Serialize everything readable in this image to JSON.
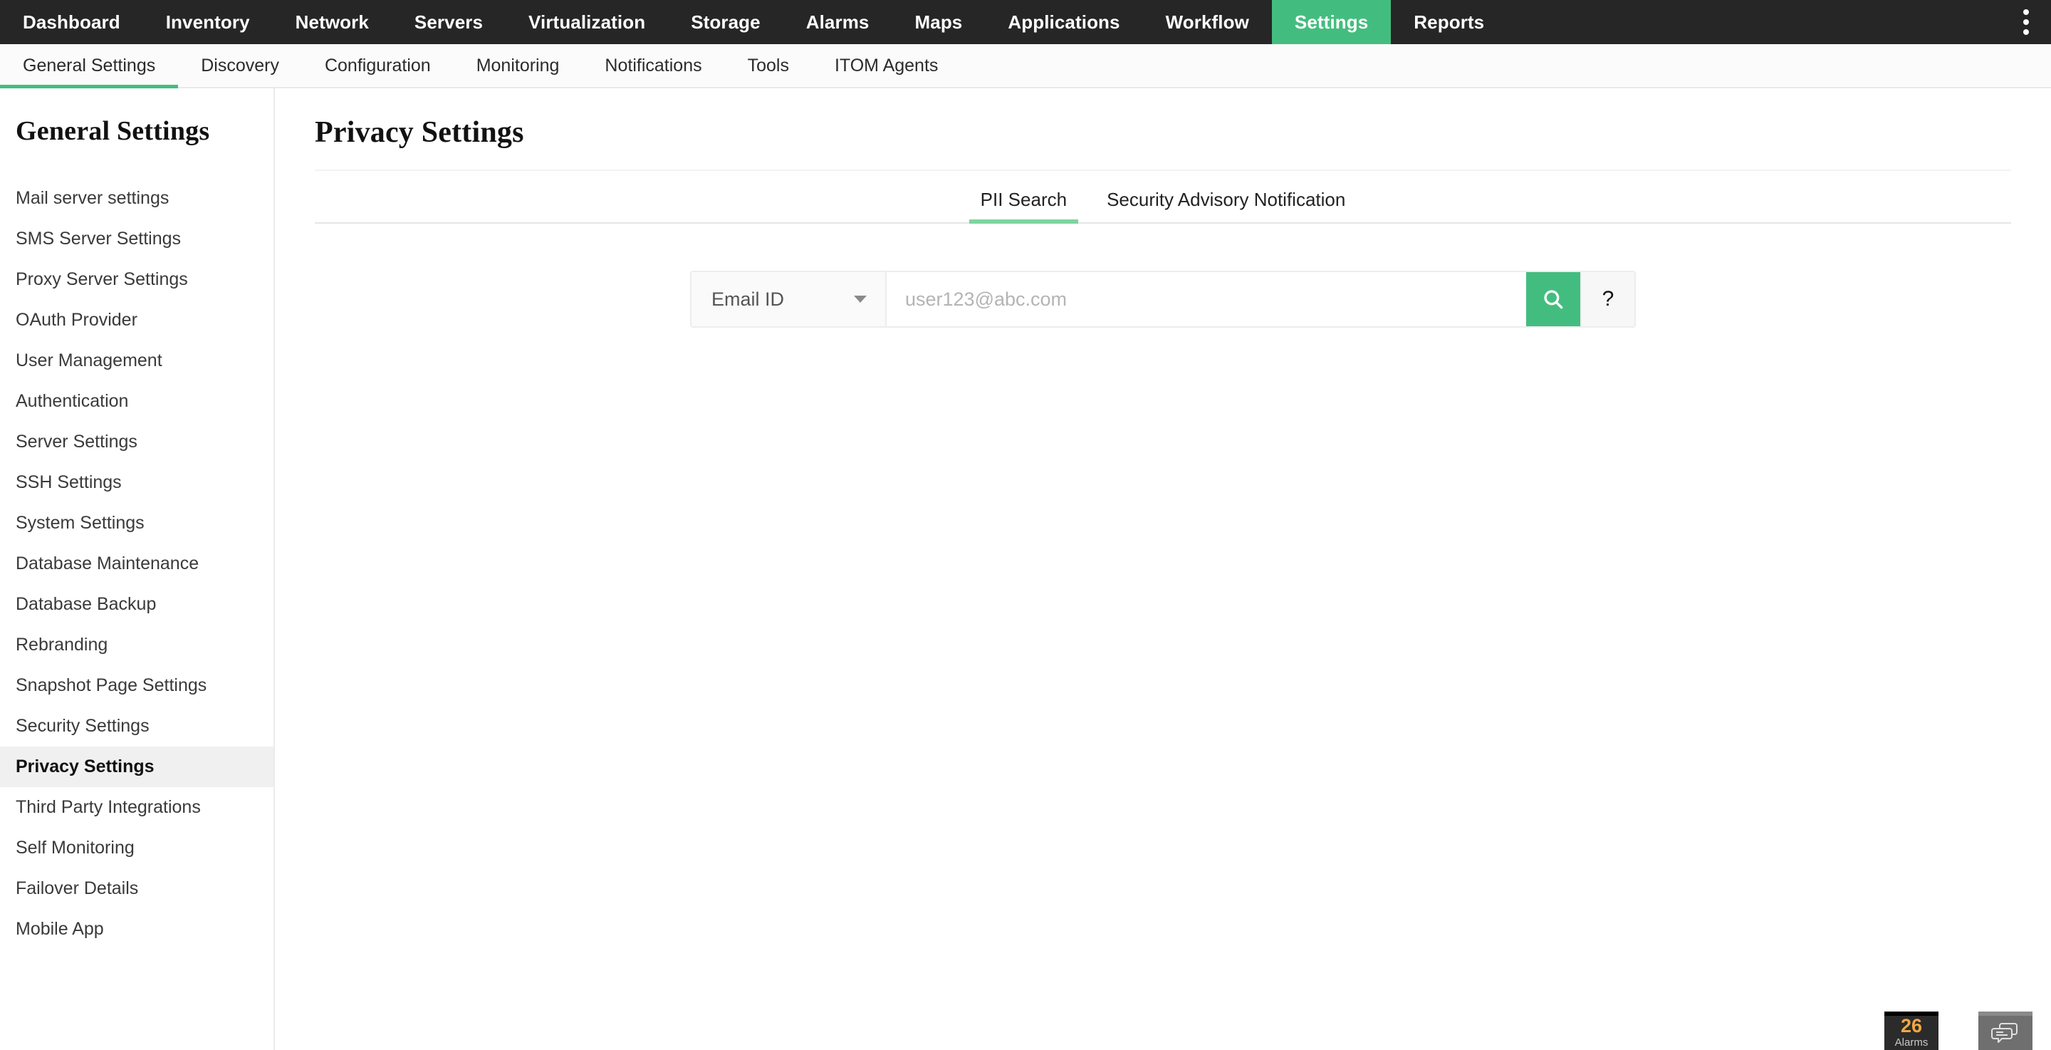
{
  "topnav": {
    "items": [
      {
        "label": "Dashboard",
        "active": false
      },
      {
        "label": "Inventory",
        "active": false
      },
      {
        "label": "Network",
        "active": false
      },
      {
        "label": "Servers",
        "active": false
      },
      {
        "label": "Virtualization",
        "active": false
      },
      {
        "label": "Storage",
        "active": false
      },
      {
        "label": "Alarms",
        "active": false
      },
      {
        "label": "Maps",
        "active": false
      },
      {
        "label": "Applications",
        "active": false
      },
      {
        "label": "Workflow",
        "active": false
      },
      {
        "label": "Settings",
        "active": true
      },
      {
        "label": "Reports",
        "active": false
      }
    ],
    "menu_icon": "kebab-menu-icon"
  },
  "subnav": {
    "items": [
      {
        "label": "General Settings",
        "active": true
      },
      {
        "label": "Discovery",
        "active": false
      },
      {
        "label": "Configuration",
        "active": false
      },
      {
        "label": "Monitoring",
        "active": false
      },
      {
        "label": "Notifications",
        "active": false
      },
      {
        "label": "Tools",
        "active": false
      },
      {
        "label": "ITOM Agents",
        "active": false
      }
    ]
  },
  "sidebar": {
    "title": "General Settings",
    "items": [
      {
        "label": "Mail server settings",
        "active": false
      },
      {
        "label": "SMS Server Settings",
        "active": false
      },
      {
        "label": "Proxy Server Settings",
        "active": false
      },
      {
        "label": "OAuth Provider",
        "active": false
      },
      {
        "label": "User Management",
        "active": false
      },
      {
        "label": "Authentication",
        "active": false
      },
      {
        "label": "Server Settings",
        "active": false
      },
      {
        "label": "SSH Settings",
        "active": false
      },
      {
        "label": "System Settings",
        "active": false
      },
      {
        "label": "Database Maintenance",
        "active": false
      },
      {
        "label": "Database Backup",
        "active": false
      },
      {
        "label": "Rebranding",
        "active": false
      },
      {
        "label": "Snapshot Page Settings",
        "active": false
      },
      {
        "label": "Security Settings",
        "active": false
      },
      {
        "label": "Privacy Settings",
        "active": true
      },
      {
        "label": "Third Party Integrations",
        "active": false
      },
      {
        "label": "Self Monitoring",
        "active": false
      },
      {
        "label": "Failover Details",
        "active": false
      },
      {
        "label": "Mobile App",
        "active": false
      }
    ]
  },
  "main": {
    "page_title": "Privacy Settings",
    "tabs": [
      {
        "label": "PII Search",
        "active": true
      },
      {
        "label": "Security Advisory Notification",
        "active": false
      }
    ],
    "search": {
      "select_value": "Email ID",
      "select_options": [
        "Email ID"
      ],
      "caret_icon": "chevron-down-icon",
      "input_value": "",
      "input_placeholder": "user123@abc.com",
      "search_icon": "search-icon",
      "help_label": "?"
    }
  },
  "footer": {
    "alarms": {
      "count": "26",
      "label": "Alarms"
    },
    "chat_icon": "chat-bubbles-icon"
  },
  "colors": {
    "accent_green": "#43bd7f",
    "tab_underline_green": "#7ed49f",
    "topnav_dark": "#262626",
    "alarm_orange": "#f0a742"
  }
}
